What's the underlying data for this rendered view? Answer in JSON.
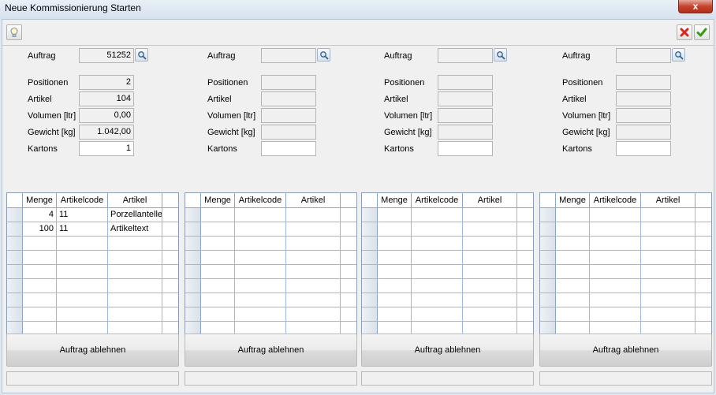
{
  "window": {
    "title": "Neue Kommissionierung Starten",
    "close_glyph": "x"
  },
  "toolbar": {
    "hint_icon": "lightbulb-icon",
    "cancel_icon": "red-x-icon",
    "confirm_icon": "green-check-icon"
  },
  "labels": {
    "auftrag": "Auftrag",
    "positionen": "Positionen",
    "artikel": "Artikel",
    "volumen": "Volumen [ltr]",
    "gewicht": "Gewicht [kg]",
    "kartons": "Kartons"
  },
  "grid_headers": [
    "Menge",
    "Artikelcode",
    "Artikel"
  ],
  "reject_label": "Auftrag ablehnen",
  "panels": [
    {
      "auftrag": "51252",
      "positionen": "2",
      "artikel": "104",
      "volumen": "0,00",
      "gewicht": "1.042,00",
      "kartons": "1",
      "rows": [
        {
          "menge": "4",
          "artikelcode": "11",
          "artikel": "Porzellantelle"
        },
        {
          "menge": "100",
          "artikelcode": "11",
          "artikel": "Artikeltext"
        }
      ]
    },
    {
      "auftrag": "",
      "positionen": "",
      "artikel": "",
      "volumen": "",
      "gewicht": "",
      "kartons": "",
      "rows": []
    },
    {
      "auftrag": "",
      "positionen": "",
      "artikel": "",
      "volumen": "",
      "gewicht": "",
      "kartons": "",
      "rows": []
    },
    {
      "auftrag": "",
      "positionen": "",
      "artikel": "",
      "volumen": "",
      "gewicht": "",
      "kartons": "",
      "rows": []
    }
  ],
  "colors": {
    "titlebar": "#dfe7ef",
    "grid_line": "#9cb8dc",
    "cancel_red": "#d9261c",
    "confirm_green": "#3c9a1a"
  }
}
